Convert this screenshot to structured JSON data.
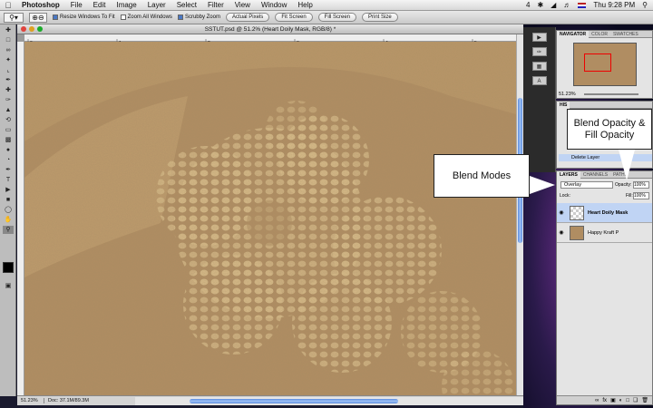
{
  "menubar": {
    "apple": "",
    "app_name": "Photoshop",
    "items": [
      "File",
      "Edit",
      "Image",
      "Layer",
      "Select",
      "Filter",
      "View",
      "Window",
      "Help"
    ],
    "status": {
      "battery_count": "4",
      "clock": "Thu 9:28 PM"
    }
  },
  "options_bar": {
    "checkboxes": [
      {
        "label": "Resize Windows To Fit",
        "checked": true
      },
      {
        "label": "Zoom All Windows",
        "checked": false
      },
      {
        "label": "Scrubby Zoom",
        "checked": true
      }
    ],
    "buttons": [
      "Actual Pixels",
      "Fit Screen",
      "Fill Screen",
      "Print Size"
    ]
  },
  "document": {
    "title": "SSTUT.psd @ 51.2% (Heart Doily Mask, RGB/8) *",
    "zoom": "51.23%",
    "doc_info": "Doc: 37.1M/89.3M",
    "ruler_ticks": [
      "0",
      "1",
      "2",
      "3",
      "4",
      "5",
      "6",
      "7",
      "8",
      "9",
      "10",
      "11",
      "12"
    ]
  },
  "navigator": {
    "tabs": [
      "NAVIGATOR",
      "COLOR",
      "SWATCHES"
    ],
    "zoom": "51.23%"
  },
  "history": {
    "tab": "HIS",
    "item": "Delete Layer"
  },
  "layers": {
    "tabs": [
      "LAYERS",
      "CHANNELS",
      "PATHS"
    ],
    "blend_mode": "Overlay",
    "opacity_label": "Opacity:",
    "opacity": "100%",
    "lock_label": "Lock:",
    "fill_label": "Fill:",
    "fill": "100%",
    "items": [
      {
        "name": "Heart Doily Mask",
        "selected": true
      },
      {
        "name": "Happy Kraft P",
        "selected": false
      }
    ]
  },
  "callouts": {
    "blend_modes": "Blend Modes",
    "blend_opacity": "Blend Opacity &\nFill Opacity"
  },
  "colors": {
    "kraft": "#b08d62",
    "lace": "#d7b985",
    "selection": "#c0d4f4",
    "accent": "#4a78c4"
  }
}
